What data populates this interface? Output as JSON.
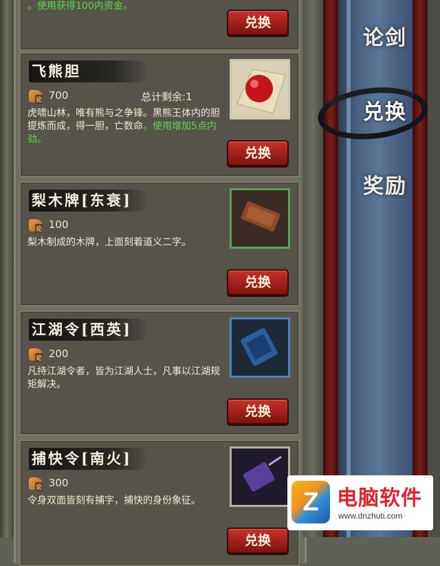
{
  "items": [
    {
      "name": "",
      "cost": "",
      "desc_plain": "",
      "desc_green": "。使用获得100内资金。",
      "button": "兑换"
    },
    {
      "name": "飞熊胆",
      "cost": "700",
      "remain": "总计剩余:1",
      "desc_plain": "虎啸山林，唯有熊与之争锋。黑熊王体内的胆提炼而成，得一胆，亡数命",
      "desc_green": "。使用增加5点内劲。",
      "button": "兑换",
      "thumb_icon": "red-orb-icon"
    },
    {
      "name": "梨木牌[东衰]",
      "cost": "100",
      "desc_plain": "梨木制成的木牌，上面刻着道义二字。",
      "button": "兑换",
      "thumb_icon": "wooden-tablet-icon"
    },
    {
      "name": "江湖令[西英]",
      "cost": "200",
      "desc_plain": "凡持江湖令者，皆为江湖人士，凡事以江湖规矩解决。",
      "button": "兑换",
      "thumb_icon": "blue-token-icon"
    },
    {
      "name": "捕快令[南火]",
      "cost": "300",
      "desc_plain": "令身双面皆刻有捕字，捕快的身份象征。",
      "button": "兑换",
      "thumb_icon": "purple-token-icon"
    }
  ],
  "coin_badge": "论",
  "tabs": [
    {
      "label": "论剑",
      "active": false
    },
    {
      "label": "兑换",
      "active": true
    },
    {
      "label": "奖励",
      "active": false
    }
  ],
  "watermark": {
    "logo": "Z",
    "title": "电脑软件",
    "url": "www.dnzhuti.com"
  },
  "colors": {
    "button_red": "#b0271f",
    "green_text": "#5fd84a",
    "sidebar_blue": "#4c6585"
  }
}
